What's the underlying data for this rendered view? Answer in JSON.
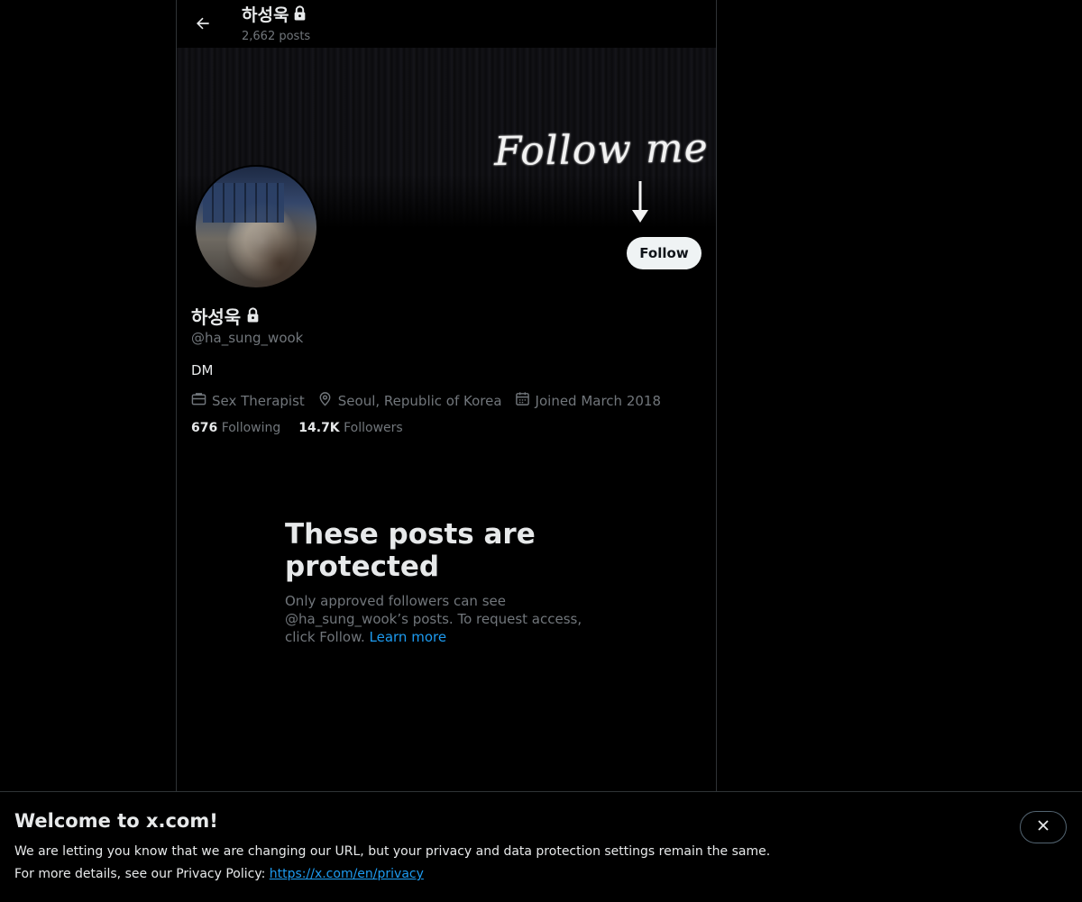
{
  "colors": {
    "background": "#000000",
    "accent": "#1d9bf0",
    "muted": "#71767b",
    "text": "#e7e9ea"
  },
  "header": {
    "name": "하성욱",
    "posts_count": "2,662 posts",
    "back_icon": "arrow-left-icon",
    "lock_icon": "lock-icon"
  },
  "banner": {
    "text": "Follow me",
    "arrow_icon": "arrow-down-icon"
  },
  "profile": {
    "name": "하성욱",
    "handle": "@ha_sung_wook",
    "bio": "DM",
    "follow_label": "Follow",
    "meta": {
      "profession": "Sex Therapist",
      "location": "Seoul, Republic of Korea",
      "joined": "Joined March 2018"
    },
    "following_count": "676",
    "following_label": "Following",
    "followers_count": "14.7K",
    "followers_label": "Followers"
  },
  "protected": {
    "title": "These posts are protected",
    "description": "Only approved followers can see @ha_sung_wook’s posts. To request access, click Follow.",
    "learn_more": "Learn more"
  },
  "cookie_bar": {
    "title": "Welcome to x.com!",
    "line1": "We are letting you know that we are changing our URL, but your privacy and data protection settings remain the same.",
    "line2_prefix": "For more details, see our Privacy Policy:",
    "privacy_link": "https://x.com/en/privacy",
    "close_icon": "close-icon"
  }
}
